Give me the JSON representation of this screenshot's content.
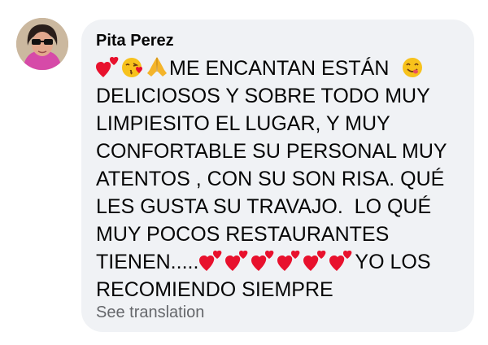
{
  "author": {
    "name": "Pita Perez",
    "avatar_icon": "profile-photo"
  },
  "comment": {
    "line1_text": "ME ENCANTAN ESTÁN",
    "line2": "DELICIOSOS Y SOBRE TODO MUY",
    "line3": "LIMPIESITO EL LUGAR, Y MUY",
    "line4": "CONFORTABLE SU PERSONAL MUY",
    "line5": "ATENTOS , CON SU SON RISA. QUÉ",
    "line6": "LES GUSTA SU TRAVAJO.  LO QUÉ",
    "line7": "MUY POCOS RESTAURANTES",
    "line8_text": "TIENEN.....",
    "line8_after": "YO LOS",
    "line9": "RECOMIENDO SIEMPRE",
    "emojis": [
      "two-hearts",
      "kissing-face",
      "folded-hands",
      "savoring-face",
      "two-hearts x6"
    ]
  },
  "actions": {
    "see_translation": "See translation"
  },
  "colors": {
    "bubble_background": "#f0f2f5",
    "text": "#050505",
    "secondary_text": "#65676b",
    "heart_red": "#e8112d"
  }
}
